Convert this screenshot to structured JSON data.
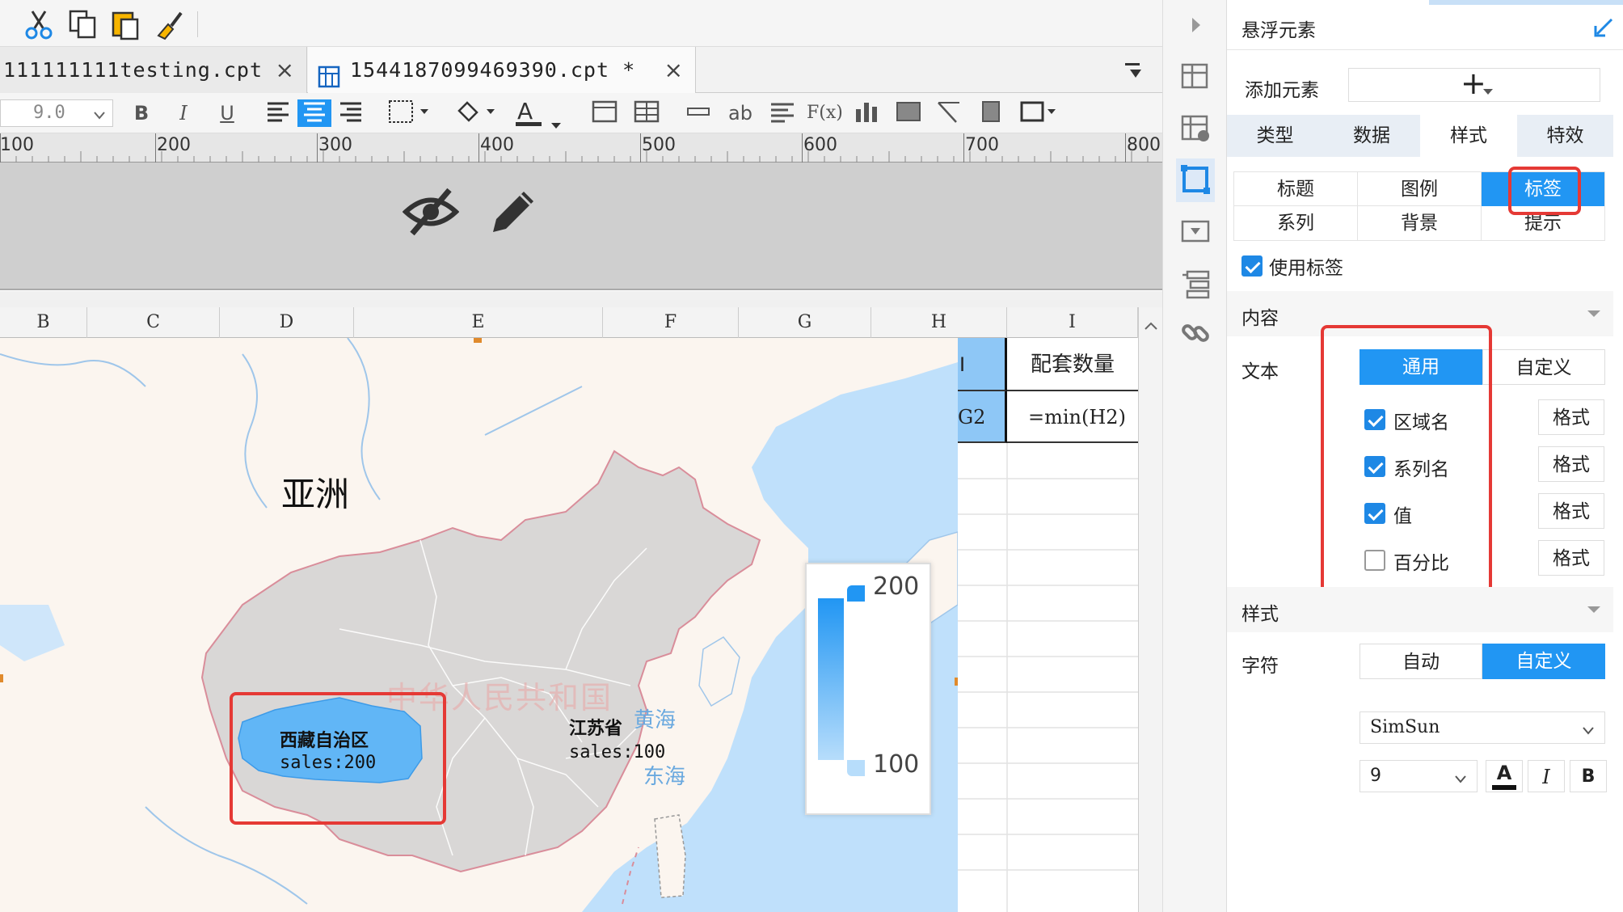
{
  "tabs": [
    {
      "label": "111111111testing.cpt",
      "close": "×",
      "active": false
    },
    {
      "label": "1544187099469390.cpt *",
      "close": "×",
      "active": true
    }
  ],
  "toolbar2": {
    "font_size": "9.0",
    "bold": "B",
    "italic": "I",
    "underline": "U",
    "font_color_letter": "A",
    "text_ab": "ab",
    "formula": "F(x)"
  },
  "ruler": {
    "ticks": [
      "100",
      "200",
      "300",
      "400",
      "500",
      "600",
      "700",
      "800"
    ]
  },
  "columns": [
    "B",
    "C",
    "D",
    "E",
    "F",
    "G",
    "H",
    "I"
  ],
  "cells": {
    "h1": "I",
    "i1": "配套数量",
    "h2": "G2",
    "i2": "=min(H2)"
  },
  "map": {
    "continent_label": "亚洲",
    "country_watermark": "中华人民共和国",
    "sea_yellow": "黄海",
    "sea_east": "东海",
    "tibet_label": {
      "region": "西藏自治区",
      "value": "sales:200"
    },
    "jiangsu_label": {
      "region": "江苏省",
      "value": "sales:100"
    },
    "legend": {
      "max": "200",
      "min": "100"
    }
  },
  "panel": {
    "title": "悬浮元素",
    "add_element_label": "添加元素",
    "add_button": "+",
    "main_tabs": [
      {
        "label": "类型",
        "active": false
      },
      {
        "label": "数据",
        "active": false
      },
      {
        "label": "样式",
        "active": true
      },
      {
        "label": "特效",
        "active": false
      }
    ],
    "sub_tabs_row1": [
      {
        "label": "标题",
        "active": false
      },
      {
        "label": "图例",
        "active": false
      },
      {
        "label": "标签",
        "active": true
      }
    ],
    "sub_tabs_row2": [
      {
        "label": "系列",
        "active": false
      },
      {
        "label": "背景",
        "active": false
      },
      {
        "label": "提示",
        "active": false
      }
    ],
    "use_label": "使用标签",
    "content_section": "内容",
    "text_label": "文本",
    "text_modes": [
      {
        "label": "通用",
        "active": true
      },
      {
        "label": "自定义",
        "active": false
      }
    ],
    "options": [
      {
        "label": "区域名",
        "checked": true,
        "format": "格式"
      },
      {
        "label": "系列名",
        "checked": true,
        "format": "格式"
      },
      {
        "label": "值",
        "checked": true,
        "format": "格式"
      },
      {
        "label": "百分比",
        "checked": false,
        "format": "格式"
      }
    ],
    "style_section": "样式",
    "char_label": "字符",
    "char_modes": [
      {
        "label": "自动",
        "active": false
      },
      {
        "label": "自定义",
        "active": true
      }
    ],
    "font_family": "SimSun",
    "font_size": "9",
    "font_color_btn": "A",
    "italic_btn": "I",
    "bold_btn": "B"
  },
  "colors": {
    "accent": "#2196f3",
    "highlight": "#e53935",
    "map_land": "#d9d7d6",
    "map_sea": "#bfe0fb",
    "map_highlight": "#61b6f6"
  }
}
